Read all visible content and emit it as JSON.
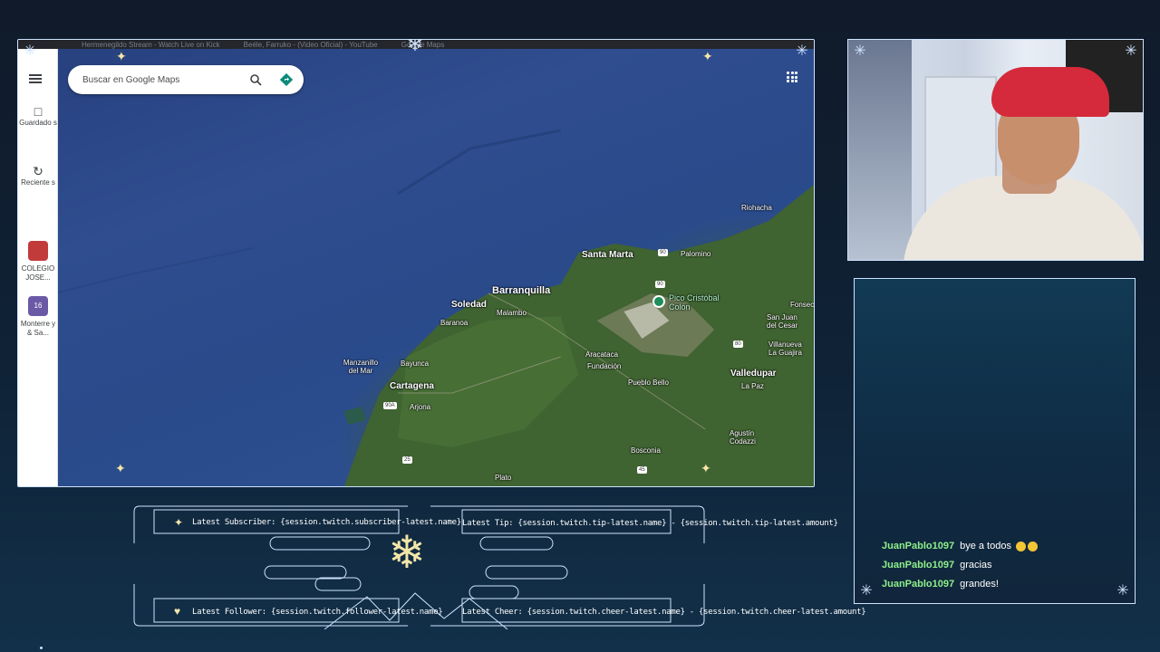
{
  "browser": {
    "tabs": [
      "Hermenegildo Stream - Watch Live on Kick",
      "Beéle, Farruko - (Video Oficial) - YouTube",
      "Google Maps"
    ]
  },
  "maps": {
    "search_placeholder": "Buscar en Google Maps",
    "sidebar": {
      "saved_label": "Guardado s",
      "recent_label": "Reciente s",
      "app1_label": "COLEGIO JOSE...",
      "app2_badge": "16",
      "app2_label": "Monterre y & Sa..."
    },
    "labels": {
      "barranquilla": "Barranquilla",
      "santa_marta": "Santa Marta",
      "soledad": "Soledad",
      "malambo": "Malambo",
      "baranoa": "Baranoa",
      "cartagena": "Cartagena",
      "arjona": "Arjona",
      "manzanillo": "Manzanillo del Mar",
      "bayunca": "Bayunca",
      "aracataca": "Aracataca",
      "fundacion": "Fundación",
      "pueblo_bello": "Pueblo Bello",
      "valledupar": "Valledupar",
      "la_paz": "La Paz",
      "agustin": "Agustín Codazzi",
      "bosconia": "Bosconia",
      "plato": "Plato",
      "palomino": "Palomino",
      "riohacha": "Riohacha",
      "san_juan": "San Juan del Cesar",
      "villanueva": "Villanueva La Guajira",
      "fonseca": "Fonsec",
      "pico": "Pico Cristóbal Colón"
    },
    "road_badges": [
      "90",
      "90",
      "80",
      "90A",
      "25",
      "45"
    ]
  },
  "chat": {
    "messages": [
      {
        "user": "JuanPablo1097",
        "text": "bye a todos"
      },
      {
        "user": "JuanPablo1097",
        "text": "gracias"
      },
      {
        "user": "JuanPablo1097",
        "text": "grandes!"
      }
    ]
  },
  "alerts": {
    "subscriber": "Latest Subscriber: {session.twitch.subscriber-latest.name}",
    "tip": "Latest Tip: {session.twitch.tip-latest.name} - {session.twitch.tip-latest.amount}",
    "follower": "Latest Follower: {session.twitch.follower-latest.name}",
    "cheer": "Latest Cheer: {session.twitch.cheer-latest.name} - {session.twitch.cheer-latest.amount}"
  },
  "colors": {
    "accent": "#cfe3ff",
    "chat_user": "#8ff08a",
    "gold": "#f3e6a9",
    "cap_red": "#d42a3b"
  }
}
